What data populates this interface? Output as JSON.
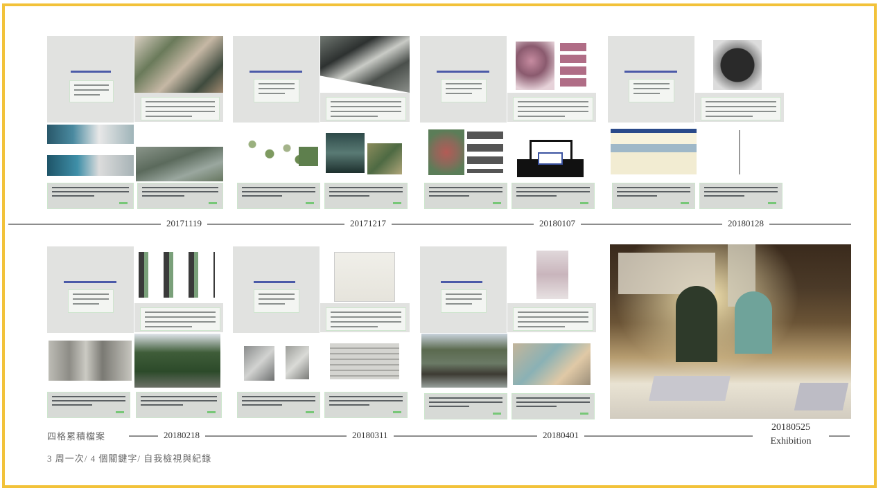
{
  "timeline": {
    "row1": [
      {
        "date": "20171119"
      },
      {
        "date": "20171217"
      },
      {
        "date": "20180107"
      },
      {
        "date": "20180128"
      }
    ],
    "row2": [
      {
        "date": "20180218"
      },
      {
        "date": "20180311"
      },
      {
        "date": "20180401"
      }
    ]
  },
  "exhibition": {
    "date": "20180525",
    "label": "Exhibition"
  },
  "notes": {
    "title": "四格累積檔案",
    "subtitle": "3 周一次/ 4 個關鍵字/ 自我檢視與紀錄"
  },
  "colors": {
    "frame": "#f2c23a",
    "timeline": "#8d8d8d"
  }
}
